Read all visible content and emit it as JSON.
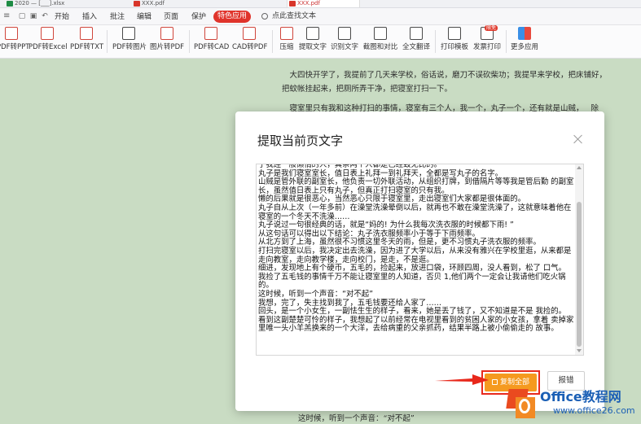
{
  "titlebar": {
    "tabs": [
      {
        "label": "2020 — [___].xlsx"
      },
      {
        "label": "ХХХ.pdf"
      },
      {
        "label": "ХХХ.pdf"
      }
    ]
  },
  "menu": {
    "items": [
      "开始",
      "插入",
      "批注",
      "编辑",
      "页面",
      "保护"
    ],
    "special": "特色应用",
    "search": "点此查找文本"
  },
  "ribbon": {
    "buttons": [
      {
        "label": "PDF转PPT",
        "icon": "pdf-to-ppt-icon"
      },
      {
        "label": "PDF转Excel",
        "icon": "pdf-to-excel-icon"
      },
      {
        "label": "PDF转TXT",
        "icon": "pdf-to-txt-icon"
      },
      {
        "label": "PDF转图片",
        "icon": "pdf-to-image-icon"
      },
      {
        "label": "图片转PDF",
        "icon": "image-to-pdf-icon"
      },
      {
        "label": "PDF转CAD",
        "icon": "pdf-to-cad-icon"
      },
      {
        "label": "CAD转PDF",
        "icon": "cad-to-pdf-icon"
      },
      {
        "label": "压缩",
        "icon": "compress-icon"
      },
      {
        "label": "提取文字",
        "icon": "extract-text-icon"
      },
      {
        "label": "识别文字",
        "icon": "ocr-icon"
      },
      {
        "label": "截图和对比",
        "icon": "screenshot-compare-icon"
      },
      {
        "label": "全文翻译",
        "icon": "translate-icon"
      },
      {
        "label": "打印模板",
        "icon": "print-template-icon"
      },
      {
        "label": "发票打印",
        "icon": "invoice-print-icon",
        "badge": "限免"
      },
      {
        "label": "更多应用",
        "icon": "more-apps-icon"
      }
    ]
  },
  "document": {
    "paragraphs": [
      "大四快开学了，我提前了几天来学校，俗话说，磨刀不误砍柴功；我提早来学校，把床铺好，   把蚊帐挂起来，把厕所弄干净，把寝室打扫一下。",
      "寝室里只有我和这种打扫的事情，寝室有三个人，我一个，丸子一个，还有就是山贼，   除"
    ],
    "bottom_line": "这时候，听到一个声音：“对不起”"
  },
  "dialog": {
    "title": "提取当前页文字",
    "extracted_text": "了我连一般懒惰的人，真亲两个人都是已经毁无比的。\n丸子是我们寝室室长，值日表上礼拜一到礼拜天，全都是写丸子的名字。\n山贼是管外联的副室长，他负责一切外联活动，从组织打牌，到借隔片等等我是管后勤 的副室长，虽然值日表上只有丸子，但真正打扫寝室的只有我。\n懒的后果就是很恶心，当然恶心只限于寝室里，走出寝室们大家都是很体面的。\n丸子自从上次（一年多前）在澡堂洗澡晕倒以后，就再也不敢在澡堂洗澡了，这就意味着他在寝室的一个冬天不洗澡……\n丸子说过一句很经典的话，就是“妈的! 为什么我每次洗衣服的时候都下雨! ”\n从这句话可以得出以下结论：丸子洗衣服频率小于等于下雨频率。\n从北方到了上海，虽然很不习惯这里冬天的雨，但是，更不习惯丸子洗衣服的频率。\n打扫完寝室以后，我决定出去洗澡，因为进了大学以后，从来没有雅兴在学校里逛，从来都是走向教室，走向教学楼，走向校门，是走，不是逛。\n细进，发现地上有个硬币，五毛的，捡起来，放进口袋，环顾四周，没人看到，松了 口气。\n我捡了五毛钱的事情千万不能让寝室里的人知道，否贝 1,他们两个一定会让我请他们吃火锅的。\n这时候，听到一个声音：“对不起”\n我想，完了，失主找到我了，五毛钱要还给人家了……\n回头，是一个小女生，一副怯生生的样子，看来，她是丢了钱了，又不知道是不是 我捡的。\n看到这副楚楚可怜的样子，我想起了以前经常在电视里看到的贫困人家的小女孩，拿着 卖掉家里唯一头小羊羔换来的一个大洋，去给病重的父亲抓药，结果半路上被小偷偷走的 故事。",
    "copy_all": "复制全部",
    "report": "报错"
  },
  "watermark": {
    "name": "Office教程网",
    "url": "www.office26.com"
  }
}
